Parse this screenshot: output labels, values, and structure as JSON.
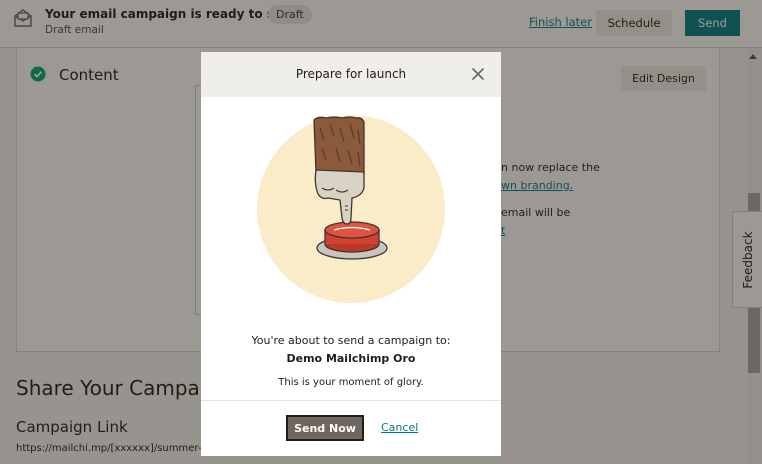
{
  "header": {
    "title": "Your email campaign is ready to send!",
    "badge": "Draft",
    "subtitle": "Draft email",
    "finish_later": "Finish later",
    "schedule": "Schedule",
    "send": "Send",
    "icon": "envelope-icon"
  },
  "content_section": {
    "title": "Content",
    "edit_design": "Edit Design",
    "icon": "check-circle-icon",
    "partial_text_1": "n now replace the",
    "partial_link_1": "wn branding.",
    "partial_text_2": "email will be",
    "partial_link_2": "t"
  },
  "share": {
    "title": "Share Your Campai",
    "link_label": "Campaign Link",
    "link_url": "https://mailchi.mp/[xxxxxx]/summer-c"
  },
  "feedback": {
    "label": "Feedback"
  },
  "modal": {
    "title": "Prepare for launch",
    "line1": "You're about to send a campaign to:",
    "audience": "Demo Mailchimp Oro",
    "line3": "This is your moment of glory.",
    "send_now": "Send Now",
    "cancel": "Cancel",
    "illustration": "finger-pressing-red-button-illustration"
  },
  "colors": {
    "accent": "#007c89",
    "primary_text": "#241c15",
    "illustration_bg": "#fbecc9",
    "button_red": "#d14330"
  }
}
